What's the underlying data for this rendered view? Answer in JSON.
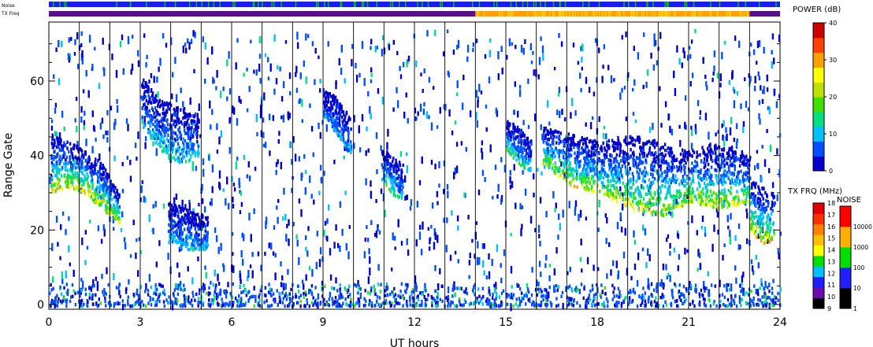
{
  "chart_data": {
    "type": "heatmap",
    "xlabel": "UT hours",
    "ylabel": "Range Gate",
    "xlim": [
      0,
      24
    ],
    "ylim": [
      0,
      75
    ],
    "x_ticks": [
      "0",
      "3",
      "6",
      "9",
      "12",
      "15",
      "18",
      "21",
      "24"
    ],
    "y_ticks": [
      "0",
      "20",
      "40",
      "60"
    ],
    "hour_markers": [
      1,
      2,
      3,
      4,
      5,
      6,
      7,
      8,
      9,
      10,
      11,
      12,
      13,
      14,
      15,
      16,
      17,
      18,
      19,
      20,
      21,
      22,
      23
    ],
    "echo_regions": [
      {
        "x0": 0.05,
        "x1": 2.3,
        "gate_top": [
          46,
          44,
          42,
          38,
          30
        ],
        "gate_bottom": [
          30,
          32,
          30,
          26,
          22
        ],
        "peak_dB": 25
      },
      {
        "x0": 3.0,
        "x1": 4.9,
        "gate_top": [
          62,
          55,
          54,
          50
        ],
        "gate_bottom": [
          48,
          42,
          38,
          40
        ],
        "peak_dB": 12
      },
      {
        "x0": 3.9,
        "x1": 5.2,
        "gate_top": [
          28,
          26,
          24
        ],
        "gate_bottom": [
          17,
          15,
          15
        ],
        "peak_dB": 10
      },
      {
        "x0": 9.0,
        "x1": 9.9,
        "gate_top": [
          58,
          56,
          50
        ],
        "gate_bottom": [
          50,
          46,
          40
        ],
        "peak_dB": 8
      },
      {
        "x0": 10.9,
        "x1": 11.6,
        "gate_top": [
          42,
          40,
          38
        ],
        "gate_bottom": [
          34,
          30,
          28
        ],
        "peak_dB": 14
      },
      {
        "x0": 15.0,
        "x1": 15.8,
        "gate_top": [
          50,
          48,
          44
        ],
        "gate_bottom": [
          42,
          38,
          36
        ],
        "peak_dB": 14
      },
      {
        "x0": 16.2,
        "x1": 23.0,
        "gate_top": [
          48,
          46,
          44,
          46,
          44,
          42,
          44,
          40
        ],
        "gate_bottom": [
          38,
          32,
          30,
          26,
          24,
          28,
          26,
          28
        ],
        "peak_dB": 22
      },
      {
        "x0": 23.0,
        "x1": 23.8,
        "gate_top": [
          34,
          32,
          30
        ],
        "gate_bottom": [
          20,
          16,
          18
        ],
        "peak_dB": 26
      }
    ],
    "noise_floor": {
      "gates": [
        0,
        6
      ],
      "x0": 0,
      "x1": 24
    },
    "tx_freq_bar": [
      {
        "x0": 0,
        "x1": 14.0,
        "freq_mhz": 10
      },
      {
        "x0": 14.0,
        "x1": 23.0,
        "freq_mhz": 14
      },
      {
        "x0": 23.0,
        "x1": 24,
        "freq_mhz": 10
      }
    ],
    "noise_bar": {
      "base_level": 10,
      "occasional_level": 100
    },
    "colorbars": {
      "power": {
        "title": "POWER (dB)",
        "min": 0,
        "max": 40,
        "ticks": [
          "0",
          "10",
          "20",
          "30",
          "40"
        ],
        "stops": [
          "#0000cc",
          "#0050ff",
          "#00c0ff",
          "#00e080",
          "#40e000",
          "#c0e000",
          "#ffff00",
          "#ffa000",
          "#ff4000",
          "#cc0000"
        ]
      },
      "tx_freq": {
        "title": "TX FRQ (MHz)",
        "ticks": [
          "9",
          "10",
          "11",
          "12",
          "13",
          "14",
          "15",
          "16",
          "17",
          "18"
        ],
        "colors": [
          "#000000",
          "#6a0dad",
          "#2020ff",
          "#00c0ff",
          "#00e000",
          "#ffff00",
          "#ffc000",
          "#ff8000",
          "#ff3000",
          "#e00000"
        ]
      },
      "noise": {
        "title": "NOISE",
        "ticks": [
          "1",
          "10",
          "100",
          "1000",
          "10000"
        ],
        "colors": [
          "#000000",
          "#2020ff",
          "#00e000",
          "#ffb000",
          "#ff0000"
        ]
      }
    }
  },
  "labels": {
    "noise_bar": "Noise",
    "tx_freq_bar": "TX Freq"
  },
  "colors": {
    "power_scale": [
      "#0000cc",
      "#0050ff",
      "#00c0ff",
      "#00e080",
      "#40e000",
      "#c0e000",
      "#ffff00",
      "#ffa000",
      "#ff4000",
      "#cc0000"
    ],
    "noise_bar_base": "#1a1aff",
    "noise_bar_spike": "#00c000",
    "tx_low": "#5a0f8a",
    "tx_high": "#ffa000",
    "tx_high_alt": "#ffd000"
  }
}
